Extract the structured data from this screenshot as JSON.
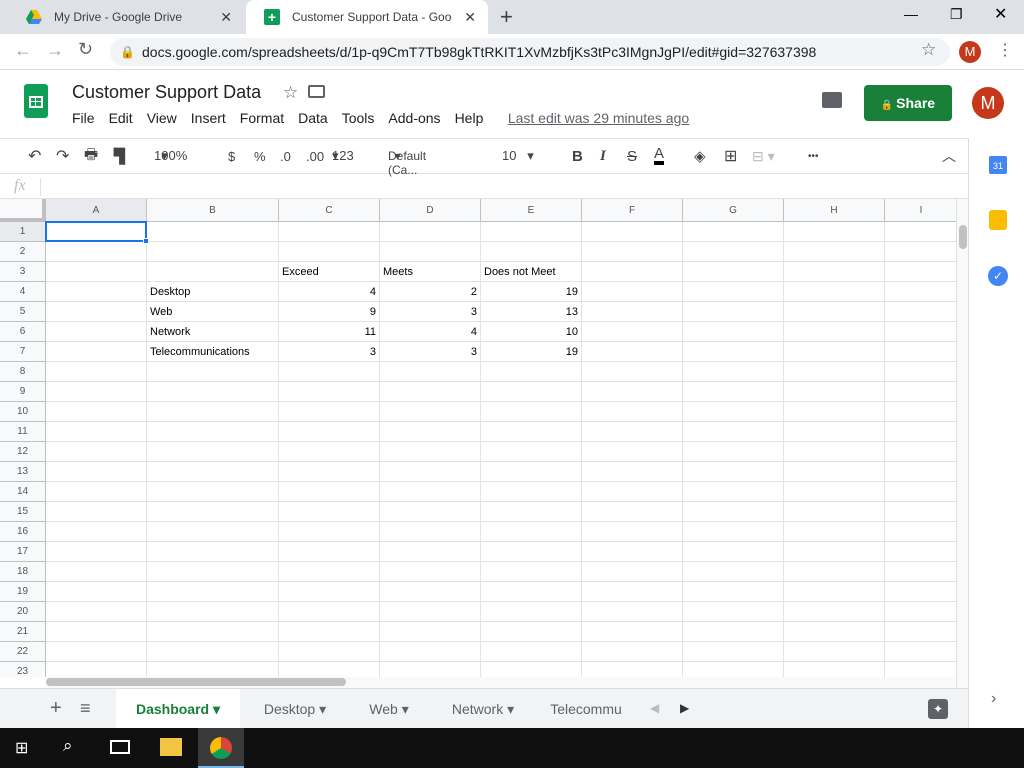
{
  "browser": {
    "tabs": [
      {
        "title": "My Drive - Google Drive",
        "icon": "google-drive-icon"
      },
      {
        "title": "Customer Support Data - Google",
        "icon": "google-sheets-icon"
      }
    ],
    "url": "docs.google.com/spreadsheets/d/1p-q9CmT7Tb98gkTtRKIT1XvMzbfjKs3tPc3IMgnJgPI/edit#gid=327637398",
    "profile_initial": "M"
  },
  "doc": {
    "title": "Customer Support Data",
    "menu": [
      "File",
      "Edit",
      "View",
      "Insert",
      "Format",
      "Data",
      "Tools",
      "Add-ons",
      "Help"
    ],
    "last_edit": "Last edit was 29 minutes ago",
    "share_label": "Share",
    "avatar_initial": "M"
  },
  "toolbar": {
    "zoom": "100%",
    "currency": "$",
    "percent": "%",
    "dec_decrease": ".0",
    "dec_increase": ".00",
    "format_more": "123",
    "font": "Default (Ca...",
    "font_size": "10",
    "bold": "B",
    "italic": "I",
    "strike": "S",
    "text_color": "A",
    "more": "•••"
  },
  "formula_bar": {
    "fx": "fx",
    "value": ""
  },
  "grid": {
    "columns": [
      "A",
      "B",
      "C",
      "D",
      "E",
      "F",
      "G",
      "H",
      "I"
    ],
    "rows": [
      "1",
      "2",
      "3",
      "4",
      "5",
      "6",
      "7",
      "8",
      "9",
      "10",
      "11",
      "12",
      "13",
      "14",
      "15",
      "16",
      "17",
      "18",
      "19",
      "20",
      "21",
      "22",
      "23"
    ],
    "headers": [
      "Exceed",
      "Meets",
      "Does not Meet"
    ],
    "data": [
      {
        "label": "Desktop",
        "values": [
          "4",
          "2",
          "19"
        ]
      },
      {
        "label": "Web",
        "values": [
          "9",
          "3",
          "13"
        ]
      },
      {
        "label": "Network",
        "values": [
          "11",
          "4",
          "10"
        ]
      },
      {
        "label": "Telecommunications",
        "values": [
          "3",
          "3",
          "19"
        ]
      }
    ]
  },
  "sheets": {
    "tabs": [
      "Dashboard",
      "Desktop",
      "Web",
      "Network",
      "Telecommu"
    ],
    "active": "Dashboard"
  },
  "colors": {
    "green": "#188038",
    "selection": "#1a73e8",
    "avatar": "#c5381a"
  }
}
